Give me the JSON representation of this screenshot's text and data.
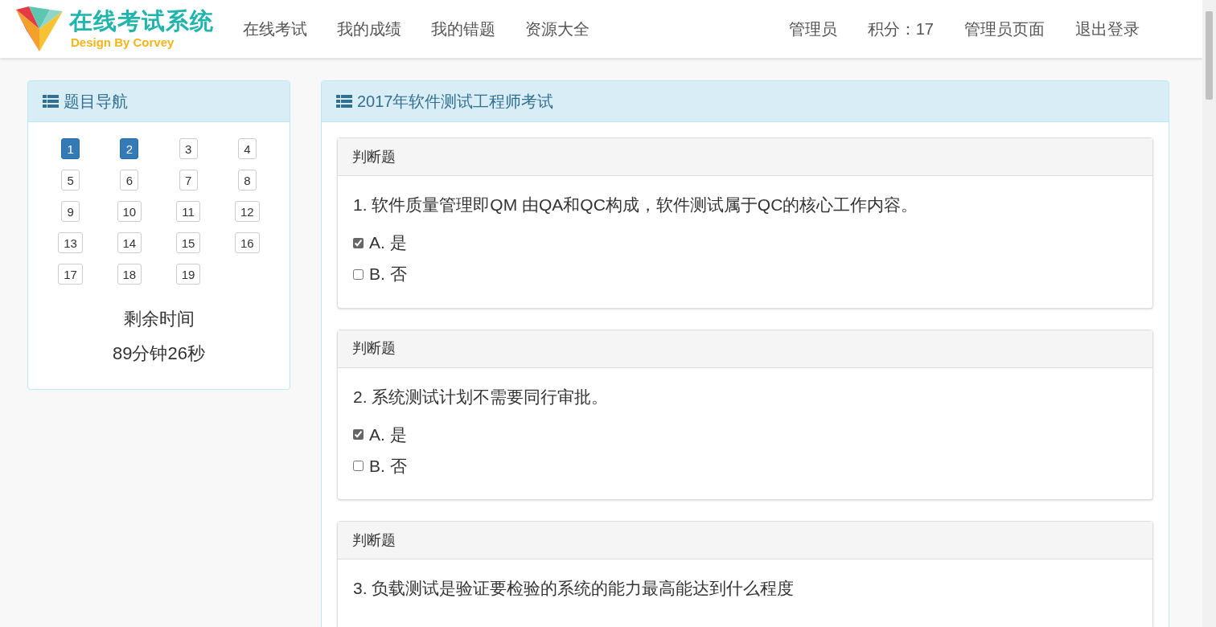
{
  "logo": {
    "title": "在线考试系统",
    "subtitle": "Design By Corvey"
  },
  "nav": {
    "items": [
      "在线考试",
      "我的成绩",
      "我的错题",
      "资源大全"
    ],
    "right_items": [
      "管理员",
      "积分：17",
      "管理员页面",
      "退出登录"
    ]
  },
  "question_nav": {
    "title": "题目导航",
    "buttons": [
      {
        "label": "1",
        "answered": true
      },
      {
        "label": "2",
        "answered": true
      },
      {
        "label": "3",
        "answered": false
      },
      {
        "label": "4",
        "answered": false
      },
      {
        "label": "5",
        "answered": false
      },
      {
        "label": "6",
        "answered": false
      },
      {
        "label": "7",
        "answered": false
      },
      {
        "label": "8",
        "answered": false
      },
      {
        "label": "9",
        "answered": false
      },
      {
        "label": "10",
        "answered": false
      },
      {
        "label": "11",
        "answered": false
      },
      {
        "label": "12",
        "answered": false
      },
      {
        "label": "13",
        "answered": false
      },
      {
        "label": "14",
        "answered": false
      },
      {
        "label": "15",
        "answered": false
      },
      {
        "label": "16",
        "answered": false
      },
      {
        "label": "17",
        "answered": false
      },
      {
        "label": "18",
        "answered": false
      },
      {
        "label": "19",
        "answered": false
      }
    ],
    "time_label": "剩余时间",
    "time_left": "89分钟26秒"
  },
  "exam": {
    "title": "2017年软件测试工程师考试",
    "questions": [
      {
        "type": "判断题",
        "text": "1. 软件质量管理即QM 由QA和QC构成，软件测试属于QC的核心工作内容。",
        "options": [
          {
            "label": "A. 是",
            "checked": true
          },
          {
            "label": "B. 否",
            "checked": false
          }
        ]
      },
      {
        "type": "判断题",
        "text": "2. 系统测试计划不需要同行审批。",
        "options": [
          {
            "label": "A. 是",
            "checked": true
          },
          {
            "label": "B. 否",
            "checked": false
          }
        ]
      },
      {
        "type": "判断题",
        "text": "3. 负载测试是验证要检验的系统的能力最高能达到什么程度"
      }
    ]
  }
}
